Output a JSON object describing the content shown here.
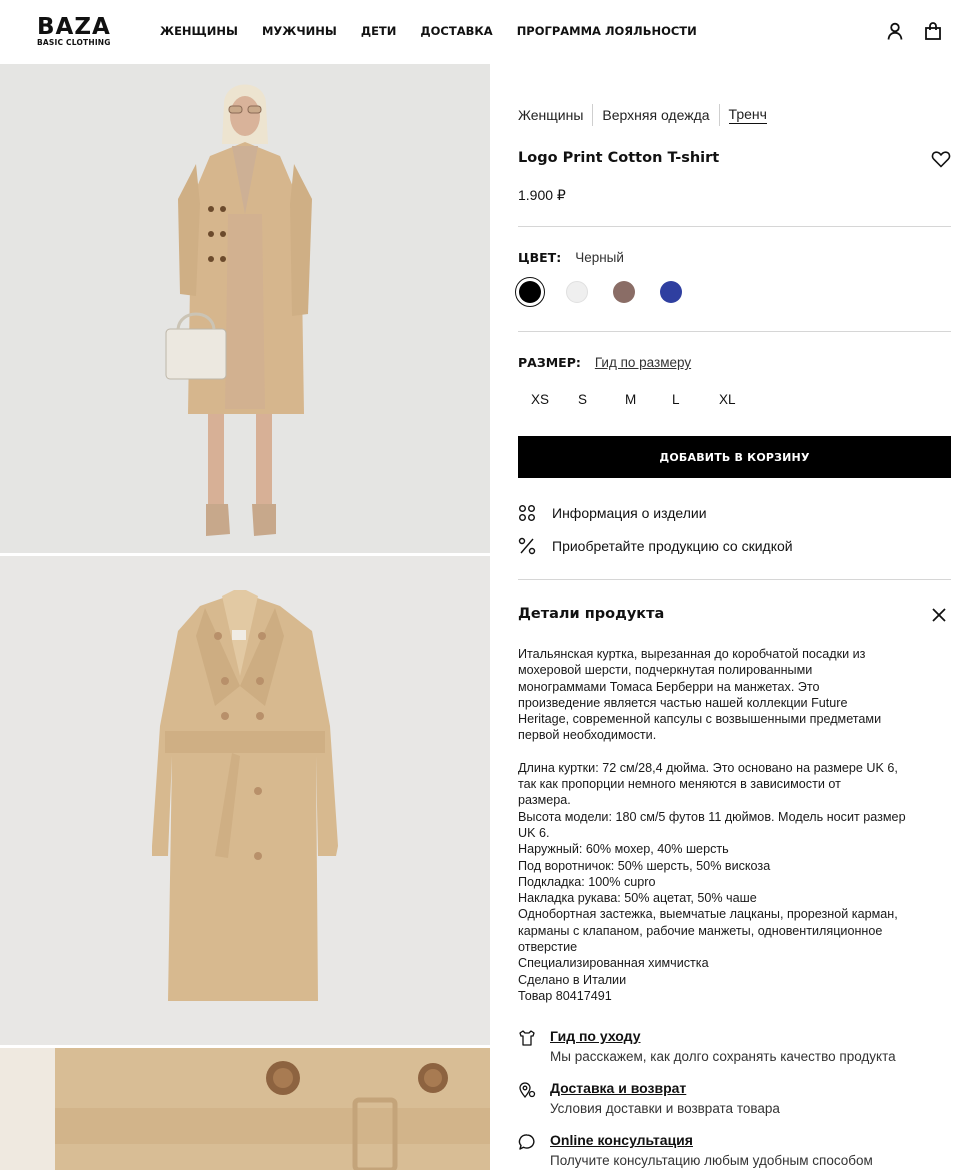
{
  "header": {
    "logo": "BAZA",
    "logo_sub": "BASIC CLOTHING",
    "nav": [
      "ЖЕНЩИНЫ",
      "МУЖЧИНЫ",
      "ДЕТИ",
      "ДОСТАВКА",
      "ПРОГРАММА ЛОЯЛЬНОСТИ"
    ],
    "icons": [
      "user-icon",
      "bag-icon"
    ]
  },
  "breadcrumbs": [
    "Женщины",
    "Верхняя одежда",
    "Тренч"
  ],
  "product": {
    "title": "Logo Print Cotton T-shirt",
    "price": "1.900 ₽",
    "color_label": "ЦВЕТ:",
    "color_value": "Черный",
    "swatches": [
      "#000000",
      "#efefef",
      "#8a6d66",
      "#2f3fa0"
    ],
    "size_label": "РАЗМЕР:",
    "size_guide": "Гид по размеру",
    "sizes": [
      "XS",
      "S",
      "M",
      "L",
      "XL"
    ],
    "add_to_cart": "ДОБАВИТЬ В КОРЗИНУ"
  },
  "info_links": [
    {
      "icon": "grid-icon",
      "label": "Информация о изделии"
    },
    {
      "icon": "percent-icon",
      "label": "Приобретайте продукцию со скидкой"
    }
  ],
  "details": {
    "heading": "Детали продукта",
    "lines": [
      "Итальянская куртка, вырезанная до коробчатой посадки из",
      "мохеровой шерсти, подчеркнутая полированными",
      "монограммами Томаса Берберри на манжетах. Это",
      "произведение является частью нашей коллекции Future",
      "Heritage, современной капсулы с возвышенными предметами",
      "первой необходимости.",
      "",
      "Длина куртки: 72 см/28,4 дюйма. Это основано на размере UK 6,",
      "так как пропорции немного меняются в зависимости от",
      "размера.",
      "Высота модели: 180 см/5 футов 11 дюймов. Модель носит размер",
      "UK 6.",
      "Наружный: 60% мохер, 40% шерсть",
      "Под воротничок: 50% шерсть, 50% вискоза",
      "Подкладка: 100% cupro",
      "Накладка рукава: 50% ацетат, 50% чаше",
      "Однобортная застежка, выемчатые лацканы, прорезной карман,",
      "карманы с клапаном, рабочие манжеты, одновентиляционное",
      "отверстие",
      "Специализированная химчистка",
      "Сделано в Италии",
      "Товар 80417491"
    ]
  },
  "services": [
    {
      "icon": "care-icon",
      "title": "Гид по уходу",
      "text": "Мы расскажем, как долго сохранять качество продукта"
    },
    {
      "icon": "delivery-pin-icon",
      "title": "Доставка и возврат",
      "text": "Условия доставки и возврата товара"
    },
    {
      "icon": "chat-icon",
      "title": "Online консультация",
      "text": "Получите консультацию любым удобным способом"
    }
  ]
}
